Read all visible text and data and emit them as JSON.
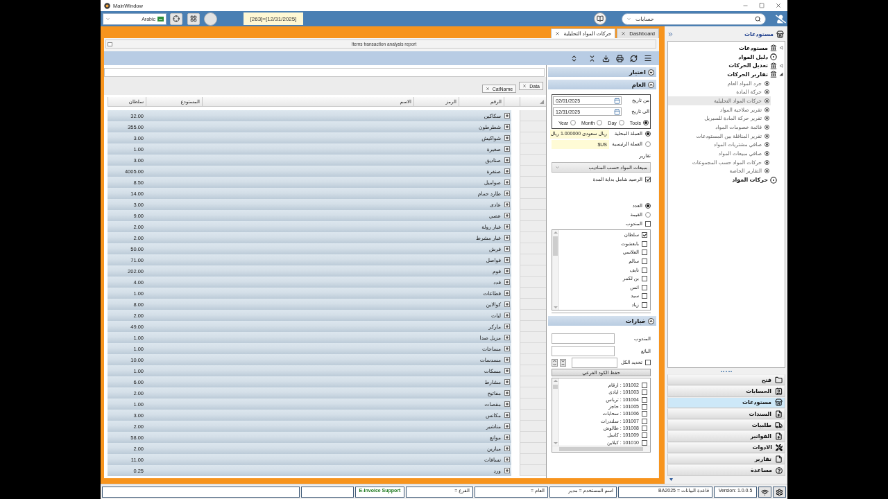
{
  "window": {
    "title": "MainWindow"
  },
  "toolbar": {
    "language": "Arabic",
    "date_label": "[263]=[12/31/2025]",
    "search": {
      "value": "حسابات"
    }
  },
  "tabs": [
    {
      "label": "Dashboard",
      "selected": false
    },
    {
      "label": "حركات المواد التحليلية",
      "selected": true
    }
  ],
  "report": {
    "title": "Items transaction analysis report",
    "group_chips": [
      "Data",
      "CatName"
    ],
    "columns": [
      "الرقم",
      "الرمز",
      "الاسم",
      "المستودع",
      "سلطان"
    ],
    "rows": [
      {
        "name": "سكاكين",
        "value": "32.00"
      },
      {
        "name": "شطرطون",
        "value": "355.00"
      },
      {
        "name": "شواكيش",
        "value": "3.00"
      },
      {
        "name": "صغيرة",
        "value": "1.00"
      },
      {
        "name": "صناديق",
        "value": "3.00"
      },
      {
        "name": "صنفرة",
        "value": "4005.00"
      },
      {
        "name": "صواميل",
        "value": "8.50"
      },
      {
        "name": "طارد حمام",
        "value": "14.00"
      },
      {
        "name": "عادى",
        "value": "3.00"
      },
      {
        "name": "عصي",
        "value": "9.00"
      },
      {
        "name": "غبار رولة",
        "value": "2.00"
      },
      {
        "name": "غبار مشرط",
        "value": "2.00"
      },
      {
        "name": "فرش",
        "value": "50.00"
      },
      {
        "name": "فواصل",
        "value": "71.00"
      },
      {
        "name": "فوم",
        "value": "202.00"
      },
      {
        "name": "قدد",
        "value": "4.00"
      },
      {
        "name": "قطاعات",
        "value": "1.00"
      },
      {
        "name": "كوالاين",
        "value": "8.00"
      },
      {
        "name": "لبات",
        "value": "2.00"
      },
      {
        "name": "ماركر",
        "value": "49.00"
      },
      {
        "name": "مزيل صدا",
        "value": "1.00"
      },
      {
        "name": "مساحات",
        "value": "1.00"
      },
      {
        "name": "مسدسات",
        "value": "10.00"
      },
      {
        "name": "مسكات",
        "value": "1.00"
      },
      {
        "name": "مشارط",
        "value": "6.00"
      },
      {
        "name": "مفاتيح",
        "value": "2.00"
      },
      {
        "name": "مقصات",
        "value": "1.00"
      },
      {
        "name": "مكانس",
        "value": "3.00"
      },
      {
        "name": "مناشير",
        "value": "2.00"
      },
      {
        "name": "موانع",
        "value": "58.00"
      },
      {
        "name": "ميازين",
        "value": "2.00"
      },
      {
        "name": "نسافات",
        "value": "11.00"
      },
      {
        "name": "ورد",
        "value": "0.25"
      }
    ]
  },
  "filter_panel": {
    "choose_section": {
      "label": "اختيار",
      "expanded": false
    },
    "general_section": {
      "label": "العام",
      "expanded": true,
      "dates": [
        {
          "label": "من تاريخ",
          "value": "02/01/2025"
        },
        {
          "label": "الى تاريخ",
          "value": "12/31/2025"
        }
      ],
      "periods": [
        {
          "label": "Tools",
          "selected": true
        },
        {
          "label": "Day",
          "selected": false
        },
        {
          "label": "Month",
          "selected": false
        },
        {
          "label": "Year",
          "selected": false
        }
      ],
      "currencies": [
        {
          "label": "العملة المحلية",
          "value": "ريال سعودى 1.000000 ريال",
          "selected": true
        },
        {
          "label": "العملة الرئيسية",
          "value": "$US",
          "selected": false
        }
      ],
      "reports_label": "تقارير",
      "report_type": "مبيعات المواد حسب المناديب",
      "opening_balance": {
        "label": "الرصيد شامل بداية المدة",
        "checked": true
      },
      "measures": [
        {
          "label": "العدد",
          "selected": true
        },
        {
          "label": "القيمة",
          "selected": false
        }
      ],
      "salesman_filter": {
        "label": "المندوب",
        "checked": false
      },
      "salesmen": [
        {
          "label": "سلطان",
          "checked": true
        },
        {
          "label": "بابعشوت",
          "checked": false
        },
        {
          "label": "العلاسي",
          "checked": false
        },
        {
          "label": "سالم",
          "checked": false
        },
        {
          "label": "نايف",
          "checked": false
        },
        {
          "label": "بن لكمر",
          "checked": false
        },
        {
          "label": "انس",
          "checked": false
        },
        {
          "label": "سيد",
          "checked": false
        },
        {
          "label": "زياد",
          "checked": false
        }
      ]
    },
    "options_section": {
      "label": "خيارات",
      "expanded": true,
      "fields": [
        {
          "label": "المندوب"
        },
        {
          "label": "البائع"
        }
      ],
      "select_all": {
        "label": "تحديد الكل",
        "checked": false
      },
      "save_button": "حفظ الكود الفرعي",
      "codes": [
        {
          "label": "101002 : ارقام",
          "checked": false
        },
        {
          "label": "101003 : ايادى",
          "checked": false
        },
        {
          "label": "101004 : ترباس",
          "checked": false
        },
        {
          "label": "101005 : حاجز",
          "checked": false
        },
        {
          "label": "101006 : سحابات",
          "checked": false
        },
        {
          "label": "101007 : سلندرات",
          "checked": false
        },
        {
          "label": "101008 : طالوش",
          "checked": false
        },
        {
          "label": "101009 : كاسل",
          "checked": false
        },
        {
          "label": "101010 : كبلاين",
          "checked": false
        }
      ]
    }
  },
  "sidebar": {
    "title": "مستودعات",
    "tree": [
      {
        "label": "مستودعات",
        "kind": "bank",
        "expanded": false,
        "selected": false
      },
      {
        "label": "دليل المواد",
        "kind": "target",
        "selected": false
      },
      {
        "label": "تعديل الحركات",
        "kind": "bank",
        "expanded": false,
        "selected": false
      },
      {
        "label": "تقارير الحركات",
        "kind": "bank",
        "expanded": true,
        "selected": false,
        "children": [
          {
            "label": "جرد المواد العام",
            "kind": "report",
            "selected": false
          },
          {
            "label": "حركة المادة",
            "kind": "report",
            "selected": false
          },
          {
            "label": "حركات المواد التحليلية",
            "kind": "report",
            "selected": true
          },
          {
            "label": "تقرير صلاحية المواد",
            "kind": "report",
            "selected": false
          },
          {
            "label": "تقرير حركة المادة للسيريل",
            "kind": "report",
            "selected": false
          },
          {
            "label": "قائمة خصومات المواد",
            "kind": "report",
            "selected": false
          },
          {
            "label": "تقرير المناقلة بين المستودعات",
            "kind": "report",
            "selected": false
          },
          {
            "label": "صافي مشتريات المواد",
            "kind": "report",
            "selected": false
          },
          {
            "label": "صافي مبيعات المواد",
            "kind": "report",
            "selected": false
          },
          {
            "label": "حركات المواد حسب المجموعات",
            "kind": "report",
            "selected": false
          },
          {
            "label": "التقارير الخاصة",
            "kind": "report",
            "selected": false
          }
        ]
      },
      {
        "label": "حركات المواد",
        "kind": "target",
        "selected": false
      }
    ],
    "nav": [
      {
        "label": "فتح",
        "kind": "folder",
        "selected": false
      },
      {
        "label": "الحسابات",
        "kind": "contacts",
        "selected": false
      },
      {
        "label": "مستودعات",
        "kind": "store",
        "selected": true
      },
      {
        "label": "السندات",
        "kind": "voucher",
        "selected": false
      },
      {
        "label": "طلبيات",
        "kind": "truck",
        "selected": false
      },
      {
        "label": "الفواتير",
        "kind": "invoice",
        "selected": false
      },
      {
        "label": "الادوات",
        "kind": "tools",
        "selected": false
      },
      {
        "label": "تقارير",
        "kind": "report",
        "selected": false
      },
      {
        "label": "مساعدة",
        "kind": "help",
        "selected": false
      }
    ]
  },
  "status_bar": {
    "support": "E-Invoice Support",
    "branch": "الفرع =",
    "year": "العام =",
    "user": "اسم المستخدم = مدير",
    "database": "قاعدة البيانات = BA2025",
    "version": "Version: 1.0.0.5"
  }
}
